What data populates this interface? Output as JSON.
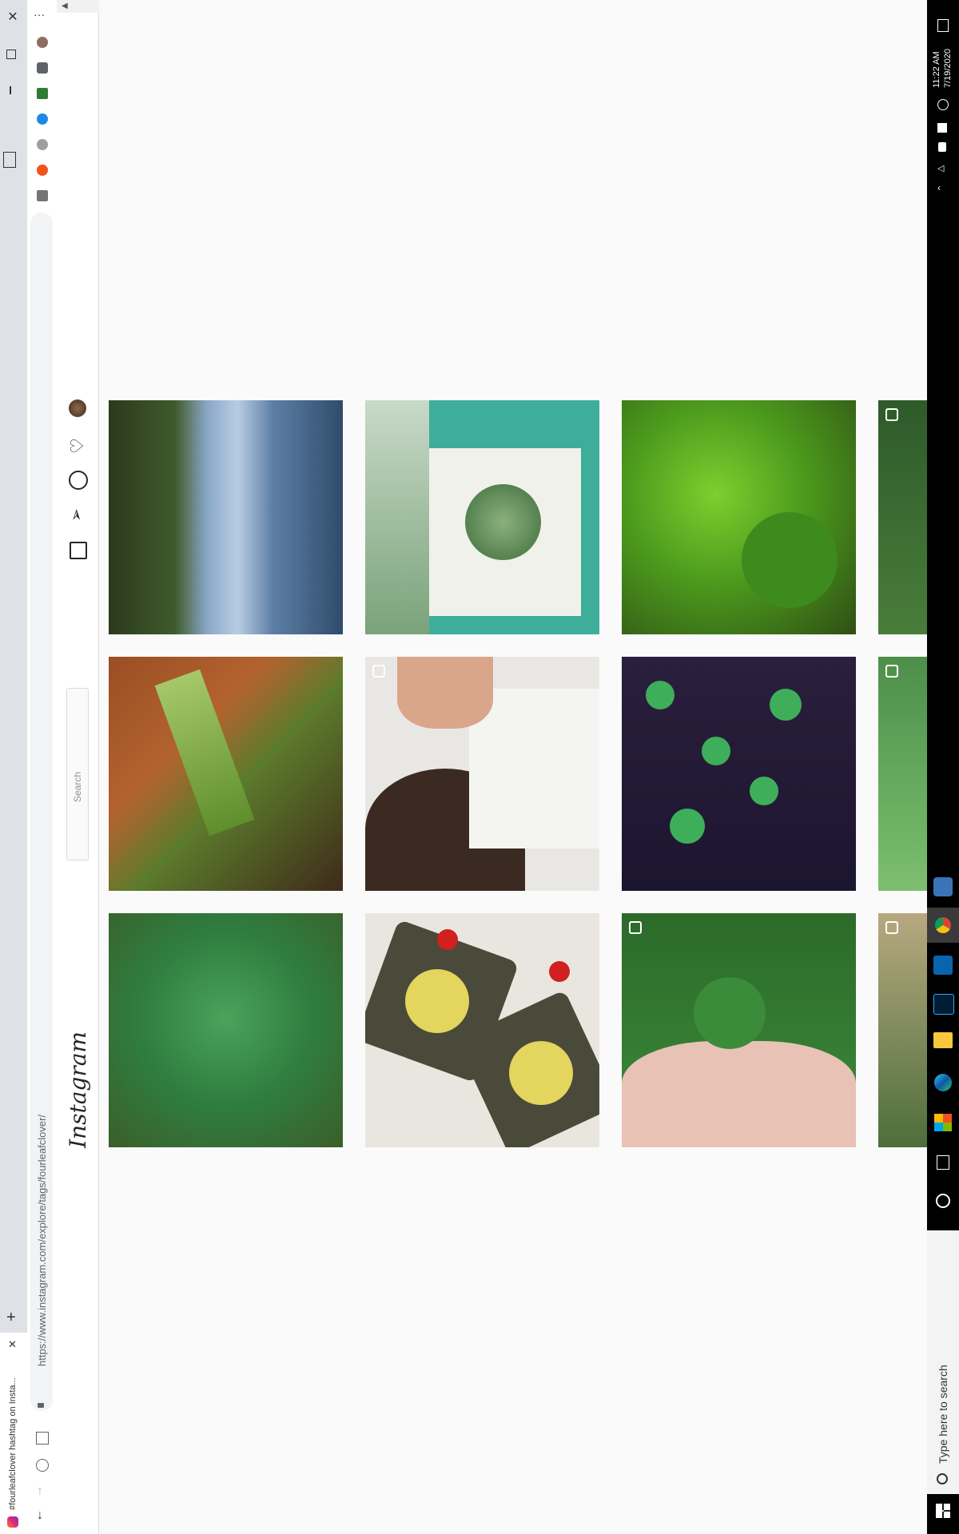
{
  "browser": {
    "tab_title": "#fourleafclover hashtag on Insta...",
    "url": "https://www.instagram.com/explore/tags/fourleafclover/",
    "new_tab_symbol": "+",
    "close_symbol": "✕",
    "menu_symbol": "···"
  },
  "instagram": {
    "logo_text": "Instagram",
    "search_placeholder": "Search"
  },
  "taskbar": {
    "time": "11:22 AM",
    "date": "7/19/2020",
    "search_placeholder": "Type here to search"
  },
  "grid": {
    "rows": [
      [
        {
          "subject": "lake with trees and sky",
          "multi": false
        },
        {
          "subject": "four leaf clover painting on paper",
          "multi": false
        },
        {
          "subject": "green clovers in vase",
          "multi": false
        },
        {
          "subject": "clover patch",
          "multi": true
        }
      ],
      [
        {
          "subject": "clover sprout in soil",
          "multi": false
        },
        {
          "subject": "person with mask and clover in hair",
          "multi": true
        },
        {
          "subject": "four clovers on dark wood",
          "multi": false
        },
        {
          "subject": "clover with water drops",
          "multi": true
        }
      ],
      [
        {
          "subject": "four leaf clover in grass",
          "multi": false
        },
        {
          "subject": "clover shaped cookies with cherries",
          "multi": false
        },
        {
          "subject": "four leaf clover on fingers",
          "multi": true
        },
        {
          "subject": "clover in dry grass",
          "multi": true
        }
      ]
    ]
  },
  "colors": {
    "page_bg": "#fafafa",
    "taskbar_bg": "#000000",
    "tabstrip_bg": "#dee1e6"
  }
}
